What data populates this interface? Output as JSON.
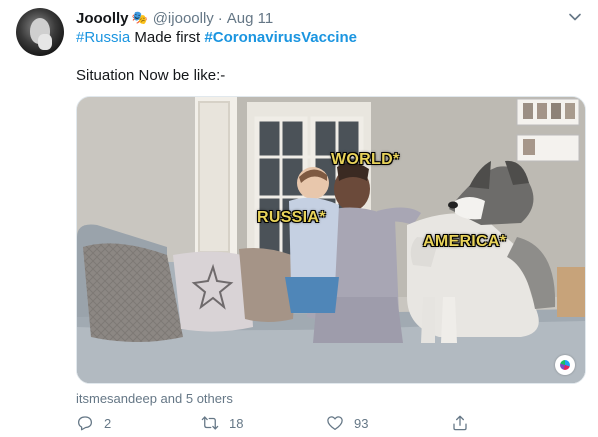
{
  "tweet": {
    "author_name": "Jooolly",
    "author_emoji": "🎭",
    "handle": "@ijooolly",
    "separator": "·",
    "time": "Aug 11",
    "hashtag1": "#Russia",
    "text1": " Made first ",
    "hashtag2": "#CoronavirusVaccine",
    "text2": "Situation Now be like:-"
  },
  "media": {
    "label_world": "WORLD*",
    "label_russia": "RUSSIA*",
    "label_america": "AMERICA*"
  },
  "social": {
    "liked_by": "itsmesandeep and 5 others"
  },
  "actions": {
    "reply_count": "2",
    "retweet_count": "18",
    "like_count": "93"
  },
  "colors": {
    "link": "#1b95e0",
    "secondary": "#657786",
    "label_fill": "#e8d35a"
  },
  "icons": [
    "chevron-down-icon",
    "reply-icon",
    "retweet-icon",
    "like-icon",
    "share-icon",
    "gif-badge-icon"
  ]
}
